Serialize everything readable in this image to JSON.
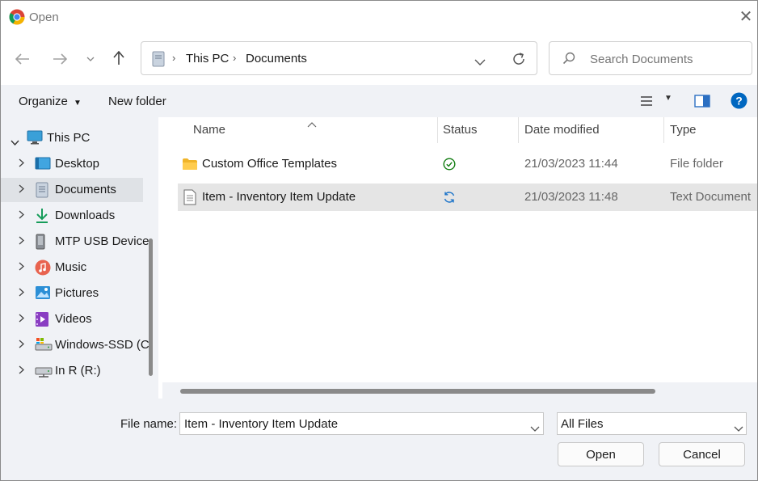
{
  "window": {
    "title": "Open"
  },
  "address": {
    "segments": [
      "This PC",
      "Documents"
    ]
  },
  "search": {
    "placeholder": "Search Documents"
  },
  "toolbar": {
    "organize_label": "Organize",
    "new_folder_label": "New folder"
  },
  "sidebar": {
    "items": [
      {
        "label": "This PC",
        "icon": "monitor-icon",
        "expanded": true
      },
      {
        "label": "Desktop",
        "icon": "desktop-icon"
      },
      {
        "label": "Documents",
        "icon": "documents-icon",
        "selected": true
      },
      {
        "label": "Downloads",
        "icon": "downloads-icon"
      },
      {
        "label": "MTP USB Device",
        "icon": "usb-device-icon"
      },
      {
        "label": "Music",
        "icon": "music-icon"
      },
      {
        "label": "Pictures",
        "icon": "pictures-icon"
      },
      {
        "label": "Videos",
        "icon": "videos-icon"
      },
      {
        "label": "Windows-SSD (C",
        "icon": "drive-icon"
      },
      {
        "label": "In R (R:)",
        "icon": "network-drive-icon"
      }
    ]
  },
  "columns": {
    "name": "Name",
    "status": "Status",
    "date": "Date modified",
    "type": "Type"
  },
  "files": [
    {
      "name": "Custom Office Templates",
      "status": "synced",
      "date": "21/03/2023 11:44",
      "type": "File folder",
      "icon": "folder-icon",
      "status_icon": "check-circle-icon"
    },
    {
      "name": "Item - Inventory Item Update",
      "status": "sync-pending",
      "date": "21/03/2023 11:48",
      "type": "Text Document",
      "icon": "text-file-icon",
      "status_icon": "sync-icon",
      "selected": true
    }
  ],
  "footer": {
    "file_name_label": "File name:",
    "file_name_value": "Item - Inventory Item Update",
    "filter_value": "All Files",
    "open_label": "Open",
    "cancel_label": "Cancel"
  },
  "colors": {
    "accent": "#0067c0",
    "selection": "#e5e5e5",
    "check_green": "#107c10"
  }
}
